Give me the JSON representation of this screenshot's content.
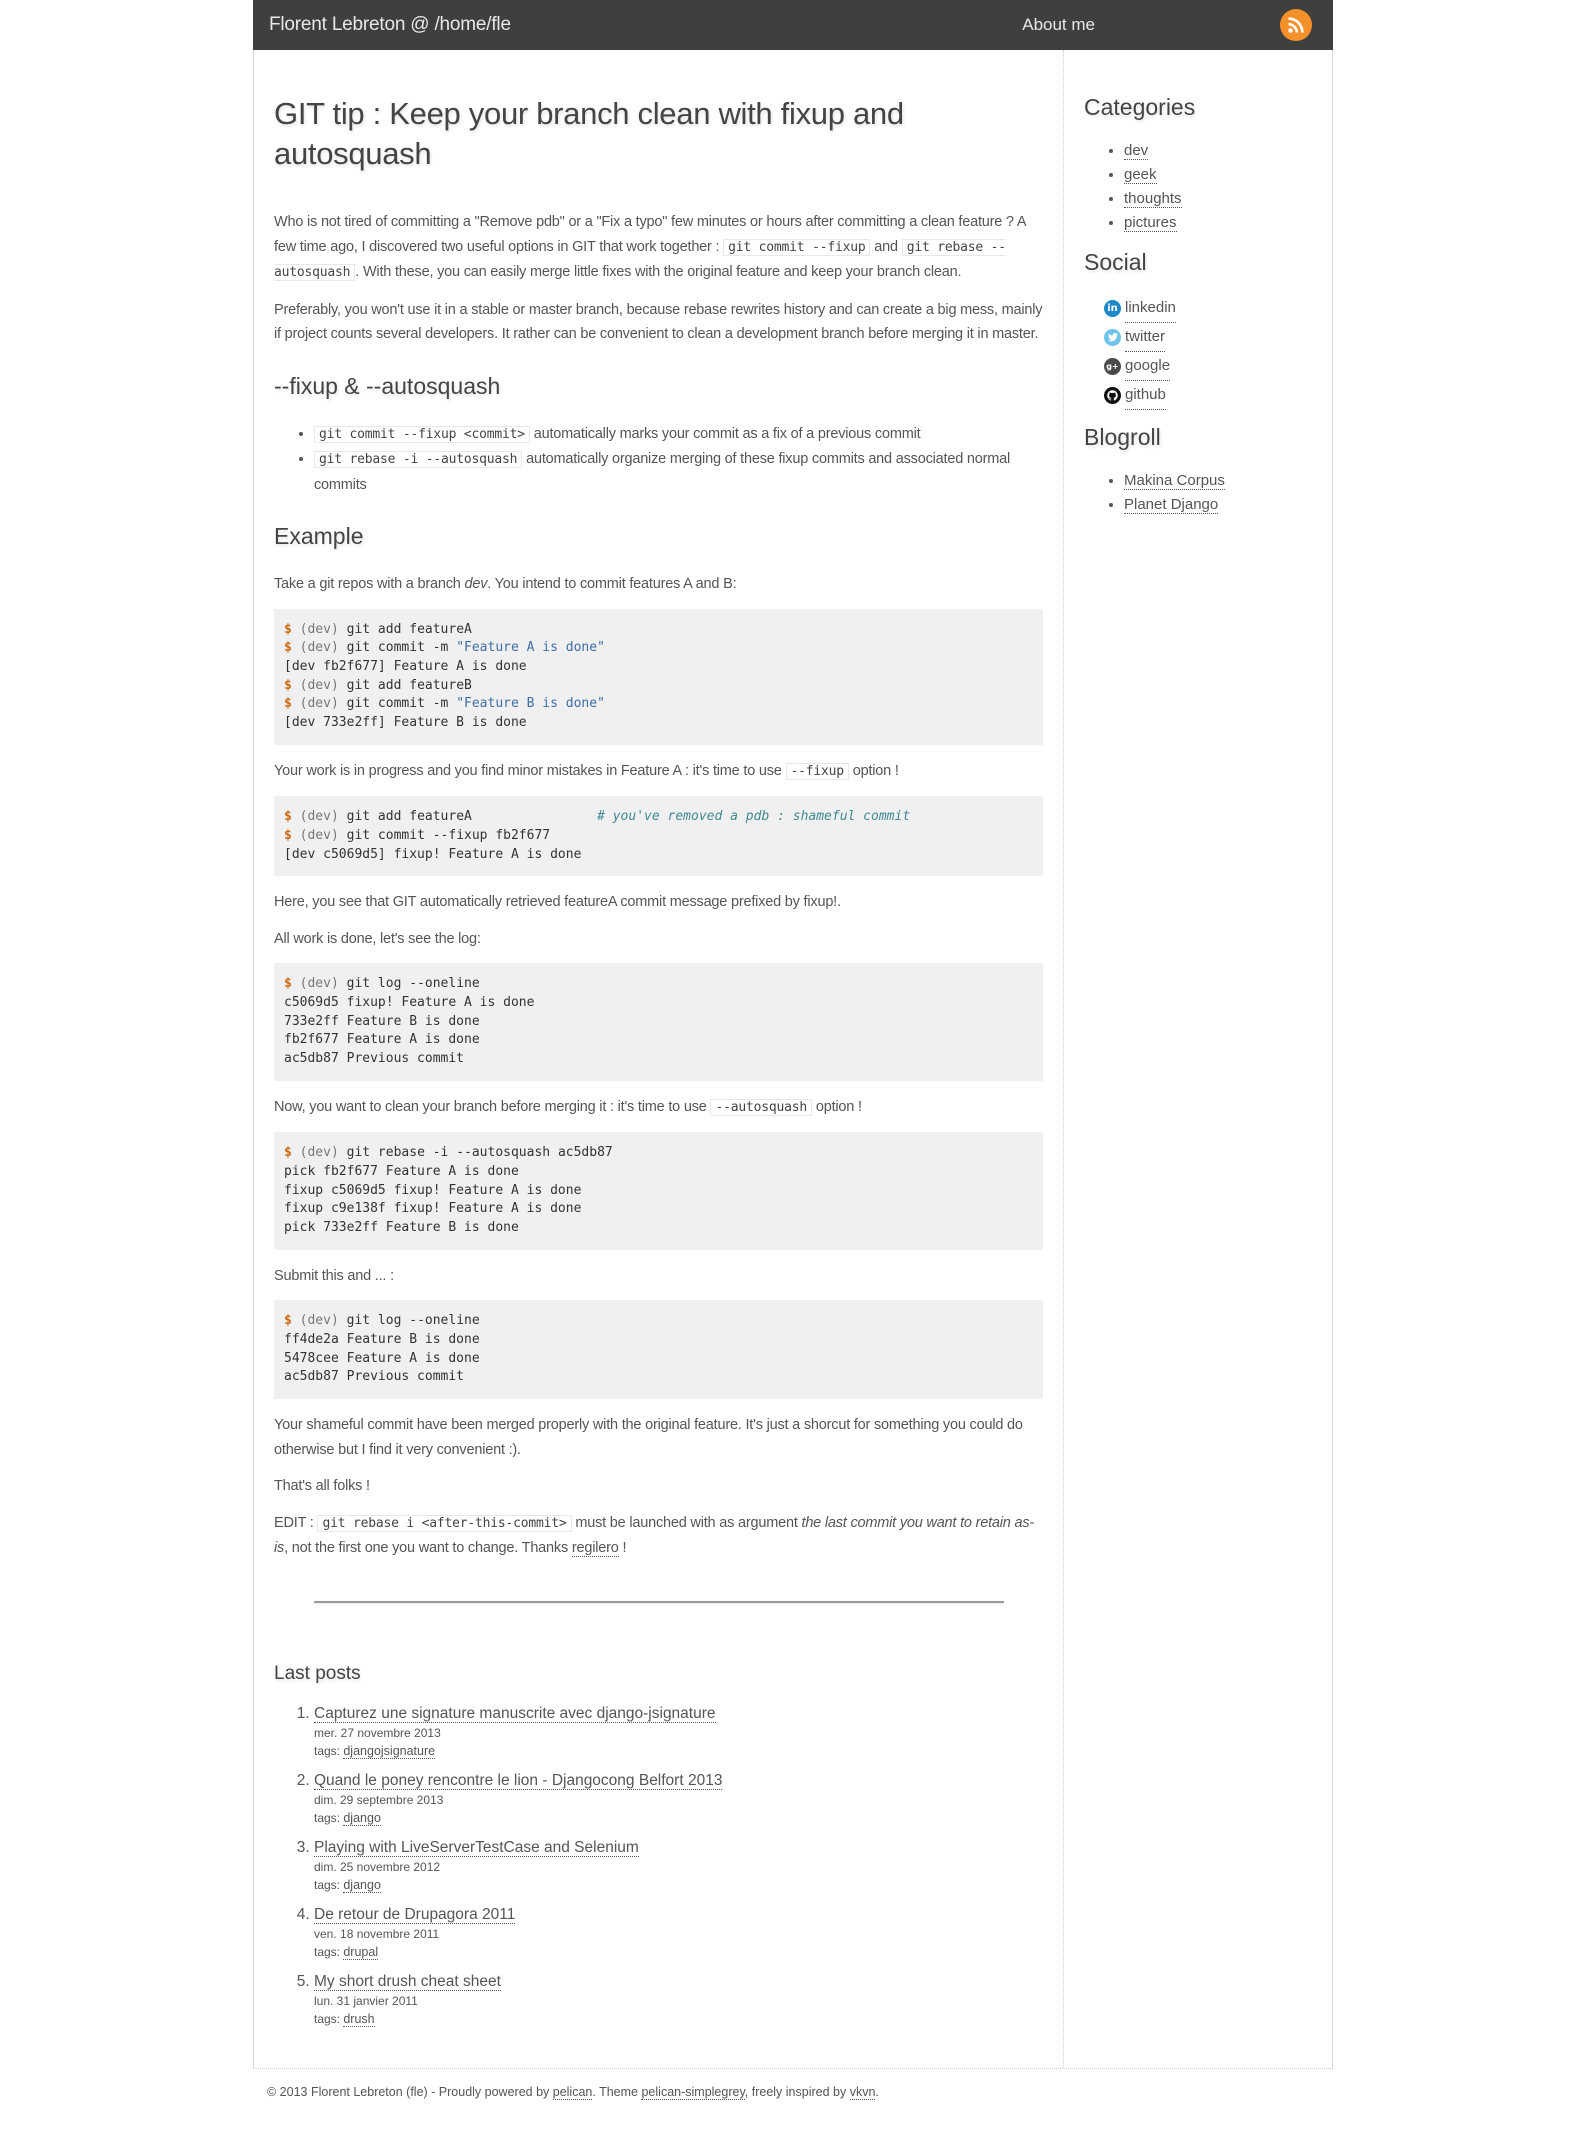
{
  "header": {
    "brand": "Florent Lebreton @ /home/fle",
    "nav_about": "About me",
    "rss_icon": "rss-icon",
    "accent": "#f5912a",
    "bg": "#3f3f3d"
  },
  "article": {
    "title": "GIT tip : Keep your branch clean with fixup and autosquash",
    "intro": {
      "t1": "Who is not tired of committing a \"Remove pdb\" or a \"Fix a typo\" few minutes or hours after committing a clean feature ? A few time ago, I discovered two useful options in GIT that work together : ",
      "c1": "git commit --fixup",
      "t2": " and ",
      "c2": "git rebase --autosquash",
      "t3": ". With these, you can easily merge little fixes with the original feature and keep your branch clean."
    },
    "para2": "Preferably, you won't use it in a stable or master branch, because rebase rewrites history and can create a big mess, mainly if project counts several developers. It rather can be convenient to clean a development branch before merging it in master.",
    "h_fixup": "--fixup & --autosquash",
    "bullets": [
      {
        "code": "git commit --fixup <commit>",
        "text": " automatically marks your commit as a fix of a previous commit"
      },
      {
        "code": "git rebase -i --autosquash",
        "text": " automatically organize merging of these fixup commits and associated normal commits"
      }
    ],
    "h_example": "Example",
    "ex_intro": {
      "t1": "Take a git repos with a branch ",
      "em": "dev",
      "t2": ". You intend to commit features A and B:"
    },
    "code1": [
      {
        "ps": "$",
        "dv": " (dev) ",
        "cmd": "git add featureA"
      },
      {
        "ps": "$",
        "dv": " (dev) ",
        "cmd": "git commit -m ",
        "str": "\"Feature A is done\""
      },
      {
        "out": "[dev fb2f677] Feature A is done"
      },
      {
        "ps": "$",
        "dv": " (dev) ",
        "cmd": "git add featureB"
      },
      {
        "ps": "$",
        "dv": " (dev) ",
        "cmd": "git commit -m ",
        "str": "\"Feature B is done\""
      },
      {
        "out": "[dev 733e2ff] Feature B is done"
      }
    ],
    "p_fixup": {
      "t1": "Your work is in progress and you find minor mistakes in Feature A : it's time to use ",
      "code": "--fixup",
      "t2": " option !"
    },
    "code2": [
      {
        "ps": "$",
        "dv": " (dev) ",
        "cmd": "git add featureA                ",
        "cm": "# you've removed a pdb : shameful commit"
      },
      {
        "ps": "$",
        "dv": " (dev) ",
        "cmd": "git commit --fixup fb2f677"
      },
      {
        "out": "[dev c5069d5] fixup! Feature A is done"
      }
    ],
    "p_here": "Here, you see that GIT automatically retrieved featureA commit message prefixed by fixup!.",
    "p_log": "All work is done, let's see the log:",
    "code3": [
      {
        "ps": "$",
        "dv": " (dev) ",
        "cmd": "git log --oneline"
      },
      {
        "out": "c5069d5 fixup! Feature A is done"
      },
      {
        "out": "733e2ff Feature B is done"
      },
      {
        "out": "fb2f677 Feature A is done"
      },
      {
        "out": "ac5db87 Previous commit"
      }
    ],
    "p_clean": {
      "t1": "Now, you want to clean your branch before merging it : it's time to use ",
      "code": "--autosquash",
      "t2": " option !"
    },
    "code4": [
      {
        "ps": "$",
        "dv": " (dev) ",
        "cmd": "git rebase -i --autosquash ac5db87"
      },
      {
        "out": "pick fb2f677 Feature A is done"
      },
      {
        "out": "fixup c5069d5 fixup! Feature A is done"
      },
      {
        "out": "fixup c9e138f fixup! Feature A is done"
      },
      {
        "out": "pick 733e2ff Feature B is done"
      }
    ],
    "p_submit": "Submit this and ... :",
    "code5": [
      {
        "ps": "$",
        "dv": " (dev) ",
        "cmd": "git log --oneline"
      },
      {
        "out": "ff4de2a Feature B is done"
      },
      {
        "out": "5478cee Feature A is done"
      },
      {
        "out": "ac5db87 Previous commit"
      }
    ],
    "p_merged": "Your shameful commit have been merged properly with the original feature. It's just a shorcut for something you could do otherwise but I find it very convenient :).",
    "p_folks": "That's all folks !",
    "p_edit": {
      "t1": "EDIT : ",
      "code": "git rebase i <after-this-commit>",
      "t2": " must be launched with as argument ",
      "em": "the last commit you want to retain as-is",
      "t3": ", not the first one you want to change. Thanks ",
      "link": "regilero",
      "t4": " !"
    }
  },
  "last_posts": {
    "title": "Last posts",
    "tags_label": "tags: ",
    "items": [
      {
        "title": "Capturez une signature manuscrite avec django-jsignature",
        "date": "mer. 27 novembre 2013",
        "tag": "djangojsignature"
      },
      {
        "title": "Quand le poney rencontre le lion - Djangocong Belfort 2013",
        "date": "dim. 29 septembre 2013",
        "tag": "django"
      },
      {
        "title": "Playing with LiveServerTestCase and Selenium",
        "date": "dim. 25 novembre 2012",
        "tag": "django"
      },
      {
        "title": "De retour de Drupagora 2011",
        "date": "ven. 18 novembre 2011",
        "tag": "drupal"
      },
      {
        "title": "My short drush cheat sheet",
        "date": "lun. 31 janvier 2011",
        "tag": "drush"
      }
    ]
  },
  "sidebar": {
    "categories_title": "Categories",
    "categories": [
      "dev",
      "geek",
      "thoughts",
      "pictures"
    ],
    "social_title": "Social",
    "social": [
      {
        "label": "linkedin",
        "icon": "linkedin-icon",
        "color": "#1e88c7"
      },
      {
        "label": "twitter",
        "icon": "twitter-icon",
        "color": "#6fc4ec"
      },
      {
        "label": "google",
        "icon": "google-plus-icon",
        "color": "#4a4a4a"
      },
      {
        "label": "github",
        "icon": "github-icon",
        "color": "#111111"
      }
    ],
    "blogroll_title": "Blogroll",
    "blogroll": [
      "Makina Corpus",
      "Planet Django"
    ]
  },
  "footer": {
    "t1": "© 2013 Florent Lebreton (fle) - Proudly powered by ",
    "l1": "pelican",
    "t2": ". Theme ",
    "l2": "pelican-simplegrey",
    "t3": ", freely inspired by ",
    "l3": "vkvn",
    "t4": "."
  }
}
